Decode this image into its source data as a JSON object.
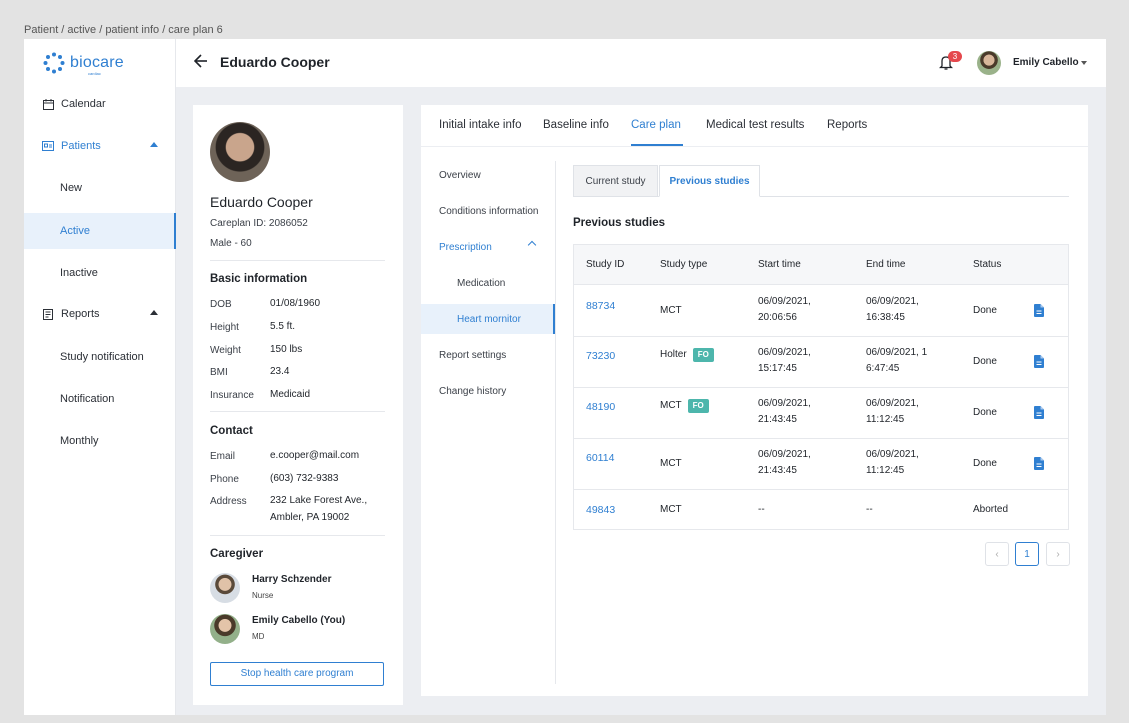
{
  "breadcrumb": "Patient / active / patient info / care plan 6",
  "brand": {
    "name": "biocare",
    "sub": "cardiac",
    "color": "#2f7fd1"
  },
  "sidebar": {
    "items": [
      {
        "label": "Calendar",
        "icon": "calendar-icon"
      },
      {
        "label": "Patients",
        "icon": "id-card-icon",
        "expanded": true
      },
      {
        "label": "New"
      },
      {
        "label": "Active",
        "selected": true
      },
      {
        "label": "Inactive"
      },
      {
        "label": "Reports",
        "icon": "report-icon",
        "expanded": true
      },
      {
        "label": "Study notification"
      },
      {
        "label": "Notification"
      },
      {
        "label": "Monthly"
      }
    ]
  },
  "header": {
    "title": "Eduardo Cooper",
    "notifications": "3",
    "user": "Emily Cabello"
  },
  "patient": {
    "name": "Eduardo Cooper",
    "careplan": "Careplan ID: 2086052",
    "sex_age": "Male - 60",
    "basic_title": "Basic information",
    "basic": [
      {
        "k": "DOB",
        "v": "01/08/1960"
      },
      {
        "k": "Height",
        "v": "5.5 ft."
      },
      {
        "k": "Weight",
        "v": "150 lbs"
      },
      {
        "k": "BMI",
        "v": "23.4"
      },
      {
        "k": "Insurance",
        "v": "Medicaid"
      }
    ],
    "contact_title": "Contact",
    "contact": [
      {
        "k": "Email",
        "v": "e.cooper@mail.com"
      },
      {
        "k": "Phone",
        "v": "(603) 732-9383"
      },
      {
        "k": "Address",
        "v": "232 Lake Forest Ave.,",
        "v2": "Ambler, PA 19002"
      }
    ],
    "caregiver_title": "Caregiver",
    "caregivers": [
      {
        "name": "Harry Schzender",
        "role": "Nurse"
      },
      {
        "name": "Emily Cabello (You)",
        "role": "MD"
      }
    ],
    "stop_label": "Stop health care program"
  },
  "tabs": [
    {
      "label": "Initial intake info"
    },
    {
      "label": "Baseline info"
    },
    {
      "label": "Care plan",
      "active": true
    },
    {
      "label": "Medical test results"
    },
    {
      "label": "Reports"
    }
  ],
  "subnav": [
    {
      "label": "Overview"
    },
    {
      "label": "Conditions information"
    },
    {
      "label": "Prescription",
      "expanded": true
    },
    {
      "label": "Medication"
    },
    {
      "label": "Heart mornitor",
      "active": true
    },
    {
      "label": "Report settings"
    },
    {
      "label": "Change history"
    }
  ],
  "subtabs": [
    {
      "label": "Current study"
    },
    {
      "label": "Previous studies",
      "active": true
    }
  ],
  "studies_title": "Previous studies",
  "table": {
    "columns": [
      "Study ID",
      "Study type",
      "Start time",
      "End time",
      "Status"
    ],
    "rows": [
      {
        "id": "88734",
        "type": "MCT",
        "fo": "",
        "start1": "06/09/2021,",
        "start2": "20:06:56",
        "end1": "06/09/2021,",
        "end2": "16:38:45",
        "status": "Done",
        "doc": true
      },
      {
        "id": "73230",
        "type": "Holter",
        "fo": "FO",
        "start1": "06/09/2021,",
        "start2": "15:17:45",
        "end1": "06/09/2021, 1",
        "end2": "6:47:45",
        "status": "Done",
        "doc": true
      },
      {
        "id": "48190",
        "type": "MCT",
        "fo": "FO",
        "start1": "06/09/2021,",
        "start2": "21:43:45",
        "end1": "06/09/2021,",
        "end2": "11:12:45",
        "status": "Done",
        "doc": true
      },
      {
        "id": "60114",
        "type": "MCT",
        "fo": "",
        "start1": "06/09/2021,",
        "start2": "21:43:45",
        "end1": "06/09/2021,",
        "end2": "11:12:45",
        "status": "Done",
        "doc": true
      },
      {
        "id": "49843",
        "type": "MCT",
        "fo": "",
        "start1": "--",
        "start2": "",
        "end1": "--",
        "end2": "",
        "status": "Aborted",
        "doc": false
      }
    ]
  },
  "pagination": {
    "prev": "‹",
    "current": "1",
    "next": "›"
  }
}
